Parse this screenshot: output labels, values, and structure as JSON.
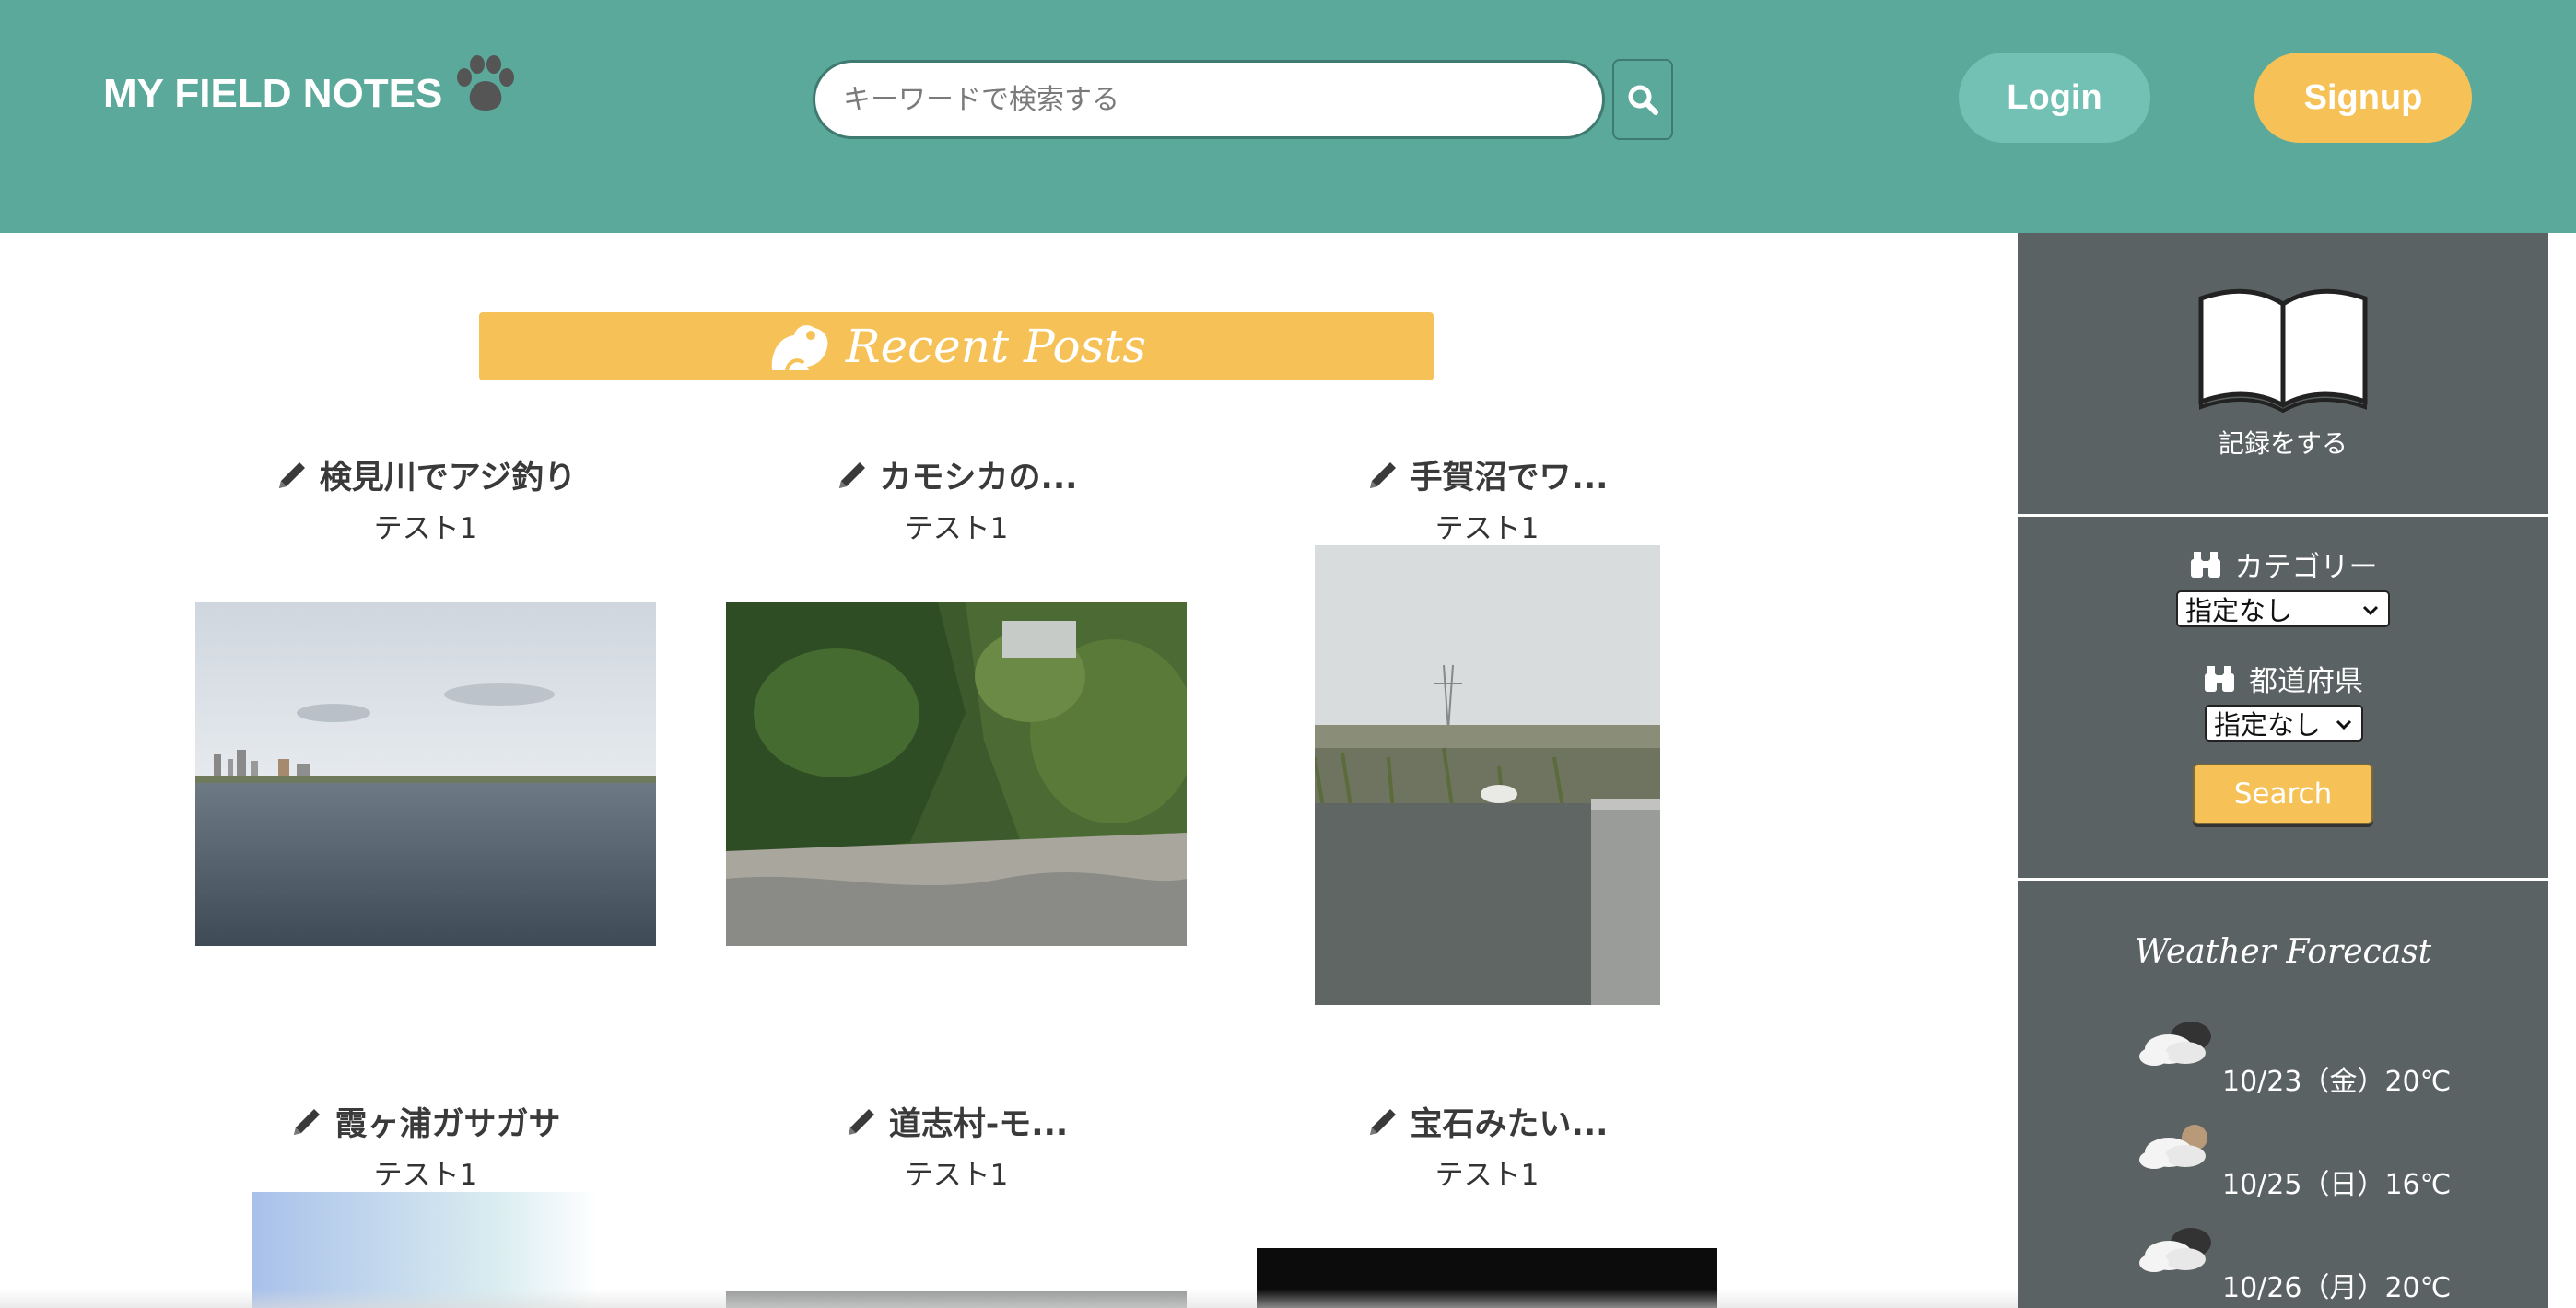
{
  "header": {
    "logo_text": "MY FIELD NOTES",
    "logo_icon": "paw-icon",
    "search_placeholder": "キーワードで検索する",
    "search_icon": "search-icon",
    "login_label": "Login",
    "signup_label": "Signup"
  },
  "main": {
    "recent_title": "Recent Posts",
    "recent_icon": "frog-icon",
    "posts": [
      {
        "title": "検見川でアジ釣り",
        "author": "テスト1",
        "image": "river-harbor-photo"
      },
      {
        "title": "カモシカの...",
        "author": "テスト1",
        "image": "mountain-stream-photo"
      },
      {
        "title": "手賀沼でワ...",
        "author": "テスト1",
        "image": "marsh-photo"
      },
      {
        "title": "霞ヶ浦ガサガサ",
        "author": "テスト1",
        "image": "sky-photo"
      },
      {
        "title": "道志村-モ...",
        "author": "テスト1",
        "image": "grey-photo"
      },
      {
        "title": "宝石みたい...",
        "author": "テスト1",
        "image": "dark-photo"
      }
    ]
  },
  "sidebar": {
    "record_label": "記録をする",
    "record_icon": "open-book-icon",
    "category_label": "カテゴリー",
    "category_value": "指定なし",
    "prefecture_label": "都道府県",
    "prefecture_value": "指定なし",
    "search_label": "Search",
    "weather_title": "Weather Forecast",
    "forecast": [
      {
        "date": "10/23（金）20℃",
        "icon": "cloud-icon"
      },
      {
        "date": "10/25（日）16℃",
        "icon": "cloud-sun-icon"
      },
      {
        "date": "10/26（月）20℃",
        "icon": "cloud-icon"
      }
    ]
  },
  "colors": {
    "header_bg": "#5aa99b",
    "accent_yellow": "#f6c258",
    "login_bg": "#72c1b4",
    "sidebar_bg": "#5b6263"
  }
}
